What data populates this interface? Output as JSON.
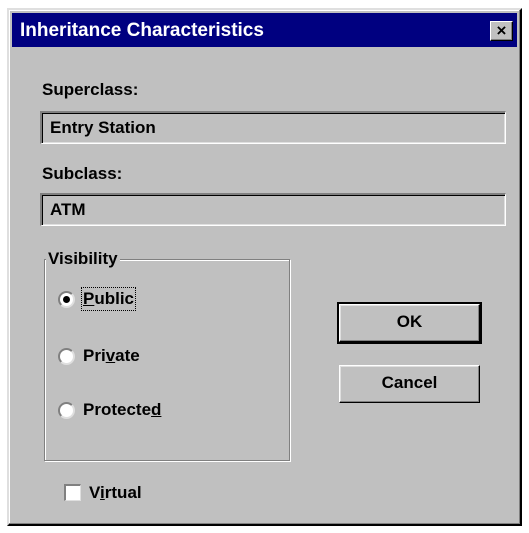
{
  "dialog": {
    "title": "Inheritance Characteristics",
    "close_glyph": "×"
  },
  "superclass": {
    "label": "Superclass:",
    "value": "Entry Station"
  },
  "subclass": {
    "label": "Subclass:",
    "value": "ATM"
  },
  "visibility": {
    "legend": "Visibility",
    "selected": "Public",
    "options": [
      {
        "before": "",
        "underlined": "P",
        "after": "ublic"
      },
      {
        "before": "Pri",
        "underlined": "v",
        "after": "ate"
      },
      {
        "before": "Protecte",
        "underlined": "d",
        "after": ""
      }
    ]
  },
  "buttons": {
    "ok_label": "OK",
    "cancel_label": "Cancel"
  },
  "virtual": {
    "before": "V",
    "underlined": "i",
    "after": "rtual",
    "checked": false
  },
  "colors": {
    "dialog_face": "#c0c0c0",
    "titlebar": "#000080"
  }
}
